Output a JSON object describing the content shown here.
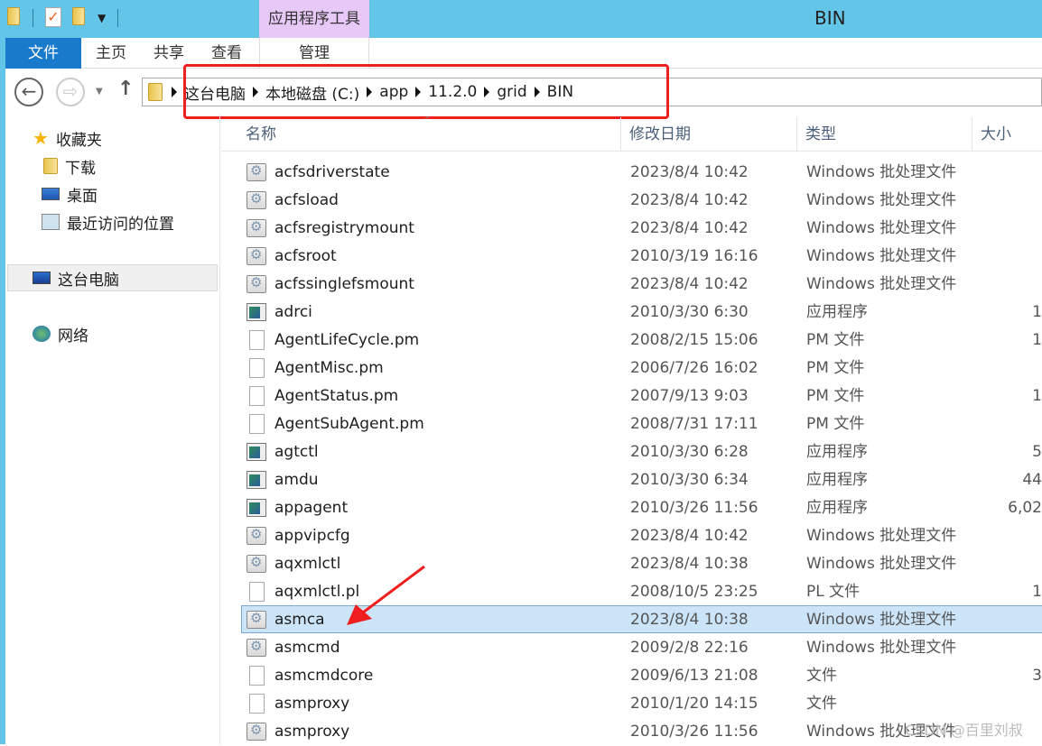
{
  "window": {
    "title": "BIN",
    "contextual_tab": "应用程序工具"
  },
  "ribbon": {
    "tabs": [
      "文件",
      "主页",
      "共享",
      "查看",
      "管理"
    ]
  },
  "address": {
    "crumbs": [
      "这台电脑",
      "本地磁盘 (C:)",
      "app",
      "11.2.0",
      "grid",
      "BIN"
    ]
  },
  "sidebar": {
    "favorites": "收藏夹",
    "items": [
      "下载",
      "桌面",
      "最近访问的位置"
    ],
    "this_pc": "这台电脑",
    "network": "网络"
  },
  "columns": [
    "名称",
    "修改日期",
    "类型",
    "大小"
  ],
  "files": [
    {
      "name": "acfsdriverstate",
      "date": "2023/8/4 10:42",
      "type": "Windows 批处理文件",
      "size": "",
      "icon": "batch-file-icon"
    },
    {
      "name": "acfsload",
      "date": "2023/8/4 10:42",
      "type": "Windows 批处理文件",
      "size": "",
      "icon": "batch-file-icon"
    },
    {
      "name": "acfsregistrymount",
      "date": "2023/8/4 10:42",
      "type": "Windows 批处理文件",
      "size": "",
      "icon": "batch-file-icon"
    },
    {
      "name": "acfsroot",
      "date": "2010/3/19 16:16",
      "type": "Windows 批处理文件",
      "size": "",
      "icon": "batch-file-icon"
    },
    {
      "name": "acfssinglefsmount",
      "date": "2023/8/4 10:42",
      "type": "Windows 批处理文件",
      "size": "",
      "icon": "batch-file-icon"
    },
    {
      "name": "adrci",
      "date": "2010/3/30 6:30",
      "type": "应用程序",
      "size": "1",
      "icon": "application-icon"
    },
    {
      "name": "AgentLifeCycle.pm",
      "date": "2008/2/15 15:06",
      "type": "PM 文件",
      "size": "1",
      "icon": "document-icon"
    },
    {
      "name": "AgentMisc.pm",
      "date": "2006/7/26 16:02",
      "type": "PM 文件",
      "size": "",
      "icon": "document-icon"
    },
    {
      "name": "AgentStatus.pm",
      "date": "2007/9/13 9:03",
      "type": "PM 文件",
      "size": "1",
      "icon": "document-icon"
    },
    {
      "name": "AgentSubAgent.pm",
      "date": "2008/7/31 17:11",
      "type": "PM 文件",
      "size": "",
      "icon": "document-icon"
    },
    {
      "name": "agtctl",
      "date": "2010/3/30 6:28",
      "type": "应用程序",
      "size": "5",
      "icon": "application-icon"
    },
    {
      "name": "amdu",
      "date": "2010/3/30 6:34",
      "type": "应用程序",
      "size": "44",
      "icon": "application-icon"
    },
    {
      "name": "appagent",
      "date": "2010/3/26 11:56",
      "type": "应用程序",
      "size": "6,02",
      "icon": "application-icon"
    },
    {
      "name": "appvipcfg",
      "date": "2023/8/4 10:42",
      "type": "Windows 批处理文件",
      "size": "",
      "icon": "batch-file-icon"
    },
    {
      "name": "aqxmlctl",
      "date": "2023/8/4 10:38",
      "type": "Windows 批处理文件",
      "size": "",
      "icon": "batch-file-icon"
    },
    {
      "name": "aqxmlctl.pl",
      "date": "2008/10/5 23:25",
      "type": "PL 文件",
      "size": "1",
      "icon": "document-icon"
    },
    {
      "name": "asmca",
      "date": "2023/8/4 10:38",
      "type": "Windows 批处理文件",
      "size": "",
      "icon": "batch-file-icon",
      "selected": true
    },
    {
      "name": "asmcmd",
      "date": "2009/2/8 22:16",
      "type": "Windows 批处理文件",
      "size": "",
      "icon": "batch-file-icon"
    },
    {
      "name": "asmcmdcore",
      "date": "2009/6/13 21:08",
      "type": "文件",
      "size": "3",
      "icon": "document-icon"
    },
    {
      "name": "asmproxy",
      "date": "2010/1/20 14:15",
      "type": "文件",
      "size": "",
      "icon": "document-icon"
    },
    {
      "name": "asmproxy",
      "date": "2010/3/26 11:56",
      "type": "Windows 批处理文件",
      "size": "",
      "icon": "batch-file-icon"
    }
  ],
  "watermark": "CSDN @百里刘叔",
  "colors": {
    "titlebar": "#63c6e8",
    "file_tab": "#1979ca",
    "contextual": "#e7c8f6",
    "annotation": "#f01f1f",
    "selection": "#cce4f7"
  }
}
